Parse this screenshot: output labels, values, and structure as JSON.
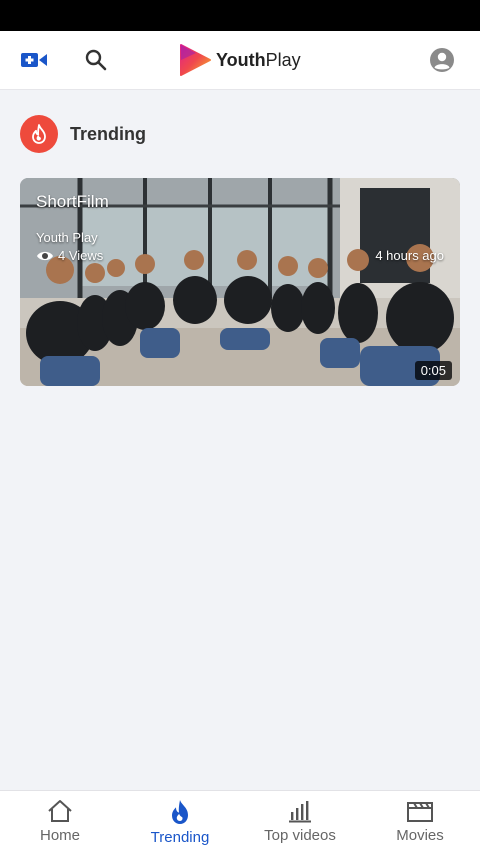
{
  "app": {
    "logo_bold": "Youth",
    "logo_rest": "Play"
  },
  "colors": {
    "accent": "#1a56c9",
    "trending_badge": "#ee4a3c",
    "create_icon": "#1a56c9"
  },
  "header": {
    "icons": [
      "video-add-icon",
      "search-icon",
      "account-icon"
    ]
  },
  "section": {
    "title": "Trending",
    "icon": "flame-icon"
  },
  "videos": [
    {
      "title": "ShortFilm",
      "channel": "Youth Play",
      "views": "4 Views",
      "time_ago": "4 hours ago",
      "duration": "0:05"
    }
  ],
  "nav": [
    {
      "label": "Home",
      "icon": "home-icon",
      "active": false
    },
    {
      "label": "Trending",
      "icon": "flame-icon",
      "active": true
    },
    {
      "label": "Top videos",
      "icon": "bar-chart-icon",
      "active": false
    },
    {
      "label": "Movies",
      "icon": "clapperboard-icon",
      "active": false
    }
  ]
}
